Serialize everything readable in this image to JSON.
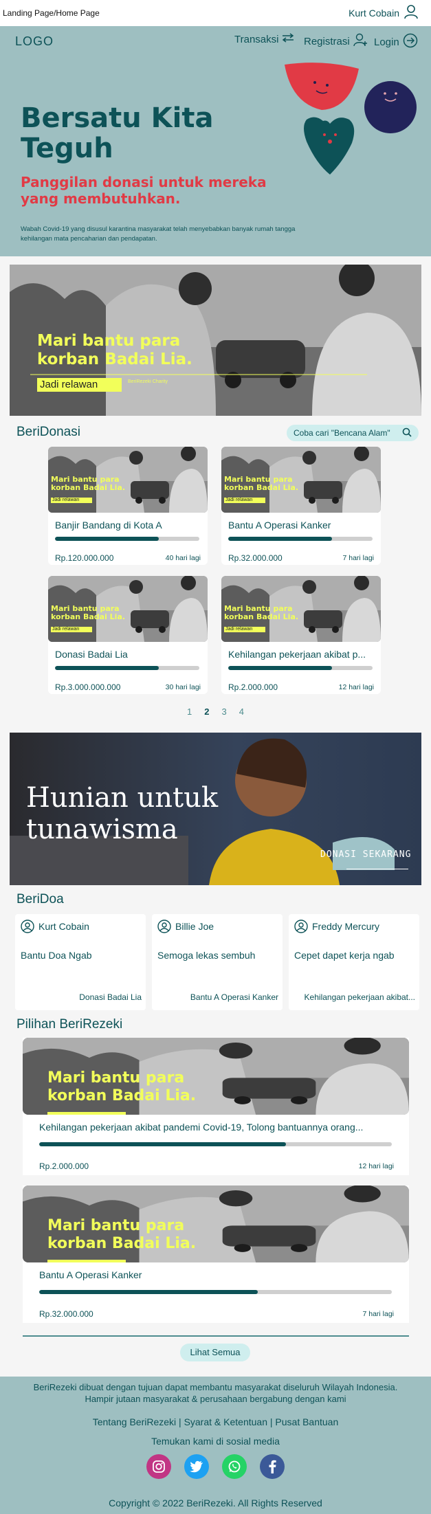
{
  "topbar": {
    "breadcrumb": "Landing Page/Home Page",
    "user_name": "Kurt Cobain"
  },
  "header": {
    "logo": "LOGO",
    "nav": [
      {
        "label": "Transaksi"
      },
      {
        "label": "Registrasi"
      },
      {
        "label": "Login"
      }
    ]
  },
  "hero": {
    "title": "Bersatu Kita Teguh",
    "subtitle": "Panggilan donasi untuk mereka yang membutuhkan.",
    "description": "Wabah Covid-19 yang disusul karantina masyarakat telah menyebabkan banyak rumah tangga kehilangan mata pencaharian dan pendapatan."
  },
  "banner": {
    "headline_1": "Mari bantu para",
    "headline_2": "korban Badai Lia.",
    "cta": "Jadi relawan",
    "badge": "BeriRezeki Charity"
  },
  "beridonasi": {
    "title": "BeriDonasi",
    "search_placeholder": "Coba cari \"Bencana Alam\"",
    "cards": [
      {
        "title": "Banjir Bandang di Kota A",
        "amount": "Rp.120.000.000",
        "days": "40 hari lagi",
        "progress": 0.72
      },
      {
        "title": "Bantu A Operasi Kanker",
        "amount": "Rp.32.000.000",
        "days": "7 hari lagi",
        "progress": 0.72
      },
      {
        "title": "Donasi Badai Lia",
        "amount": "Rp.3.000.000.000",
        "days": "30 hari lagi",
        "progress": 0.72
      },
      {
        "title": "Kehilangan pekerjaan akibat p...",
        "amount": "Rp.2.000.000",
        "days": "12 hari lagi",
        "progress": 0.72
      }
    ],
    "thumb": {
      "line_1": "Mari bantu para",
      "line_2": "korban Badai Lia.",
      "cta": "Jadi relawan"
    },
    "pages": [
      "1",
      "2",
      "3",
      "4"
    ]
  },
  "hunian": {
    "title_1": "Hunian untuk",
    "title_2": "tunawisma",
    "cta": "DONASI SEKARANG"
  },
  "beridoa": {
    "title": "BeriDoa",
    "items": [
      {
        "name": "Kurt Cobain",
        "message": "Bantu Doa Ngab",
        "campaign": "Donasi Badai Lia"
      },
      {
        "name": "Billie Joe",
        "message": "Semoga lekas sembuh",
        "campaign": "Bantu A Operasi Kanker"
      },
      {
        "name": "Freddy Mercury",
        "message": "Cepet dapet kerja ngab",
        "campaign": "Kehilangan pekerjaan akibat..."
      }
    ]
  },
  "pilihan": {
    "title": "Pilihan BeriRezeki",
    "items": [
      {
        "title": "Kehilangan pekerjaan akibat pandemi Covid-19, Tolong bantuannya orang...",
        "amount": "Rp.2.000.000",
        "days": "12 hari lagi",
        "progress": 0.7
      },
      {
        "title": "Bantu A Operasi Kanker",
        "amount": "Rp.32.000.000",
        "days": "7 hari lagi",
        "progress": 0.62
      }
    ],
    "see_all": "Lihat Semua"
  },
  "footer": {
    "tagline_1": "BeriRezeki dibuat dengan tujuan dapat membantu masyarakat diseluruh Wilayah Indonesia.",
    "tagline_2": "Hampir jutaan masyarakat & perusahaan bergabung dengan kami",
    "links": [
      "Tentang BeriRezeki",
      "Syarat & Ketentuan",
      "Pusat Bantuan"
    ],
    "social_title": "Temukan kami di sosial media",
    "social": [
      {
        "name": "instagram-icon",
        "color": "#c13584"
      },
      {
        "name": "twitter-icon",
        "color": "#1da1f2"
      },
      {
        "name": "whatsapp-icon",
        "color": "#25d366"
      },
      {
        "name": "facebook-icon",
        "color": "#3b5998"
      }
    ],
    "copyright": "Copyright © 2022 BeriRezeki. All Rights Reserved"
  },
  "colors": {
    "teal": "#0d5257",
    "hero_bg": "#9ebfc1",
    "accent_red": "#e13a45",
    "accent_yellow": "#f2ff5a",
    "pill": "#cfeeee"
  }
}
